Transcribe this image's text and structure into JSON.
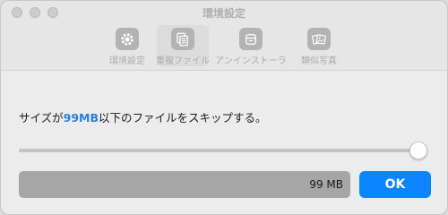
{
  "window": {
    "title": "環境設定"
  },
  "toolbar": {
    "items": [
      {
        "label": "環境設定",
        "icon": "gear-icon"
      },
      {
        "label": "重複ファイル",
        "icon": "duplicate-files-icon",
        "selected": true
      },
      {
        "label": "アンインストーラ",
        "icon": "uninstaller-icon"
      },
      {
        "label": "類似写真",
        "icon": "similar-photos-icon"
      }
    ]
  },
  "content": {
    "description_prefix": "サイズが",
    "description_size": "99MB",
    "description_suffix": "以下のファイルをスキップする。",
    "slider_level_fraction": 0.995,
    "size_value": "99 MB",
    "ok_label": "OK"
  },
  "colors": {
    "accent": "#0a84ff",
    "highlight_text": "#2b7de0",
    "window_bg": "#ececec"
  }
}
